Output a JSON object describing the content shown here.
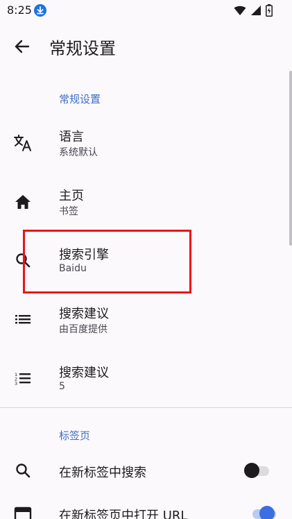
{
  "status_bar": {
    "time": "8:25",
    "download_icon": "download-icon",
    "wifi_icon": "wifi-icon",
    "signal_icon": "signal-icon",
    "battery_icon": "battery-charging-icon"
  },
  "app_bar": {
    "back_icon": "arrow-back-icon",
    "title": "常规设置"
  },
  "sections": {
    "general": "常规设置",
    "tabs": "标签页"
  },
  "items": [
    {
      "icon": "translate-icon",
      "title": "语言",
      "summary": "系统默认"
    },
    {
      "icon": "home-icon",
      "title": "主页",
      "summary": "书签"
    },
    {
      "icon": "search-icon",
      "title": "搜索引擎",
      "summary": "Baidu"
    },
    {
      "icon": "list-icon",
      "title": "搜索建议",
      "summary": "由百度提供"
    },
    {
      "icon": "numbered-list-icon",
      "title": "搜索建议",
      "summary": "5"
    }
  ],
  "tab_items": [
    {
      "icon": "search-icon",
      "title": "在新标签中搜索",
      "toggle_on": false
    },
    {
      "icon": "tab-icon",
      "title": "在新标签页中打开 URL",
      "toggle_on": true
    }
  ],
  "colors": {
    "background": "#fcf9fd",
    "accent": "#3d6fc4",
    "highlight": "#e8141a",
    "toggle_on": "#3b6ee0"
  }
}
